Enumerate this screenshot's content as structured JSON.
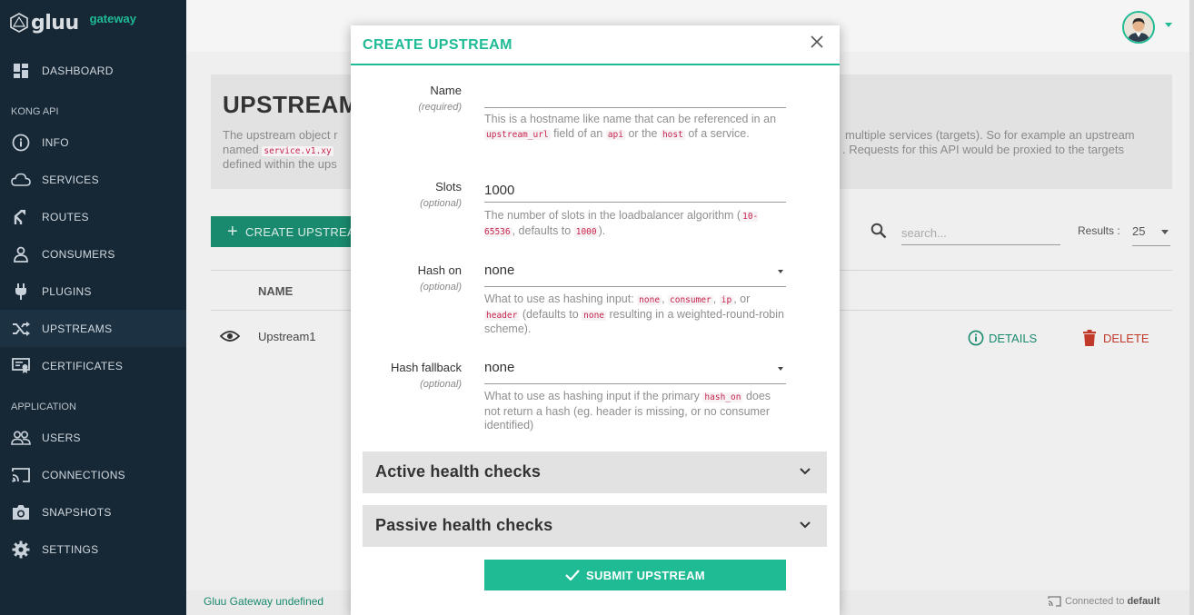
{
  "brand": {
    "name": "gluu",
    "sub": "gateway"
  },
  "sidebar": {
    "items_top": [
      {
        "label": "DASHBOARD",
        "icon": "dashboard-icon"
      }
    ],
    "section_kong": "KONG API",
    "items_kong": [
      {
        "label": "INFO",
        "icon": "info-icon"
      },
      {
        "label": "SERVICES",
        "icon": "cloud-icon"
      },
      {
        "label": "ROUTES",
        "icon": "routes-icon"
      },
      {
        "label": "CONSUMERS",
        "icon": "person-icon"
      },
      {
        "label": "PLUGINS",
        "icon": "plug-icon"
      },
      {
        "label": "UPSTREAMS",
        "icon": "shuffle-icon"
      },
      {
        "label": "CERTIFICATES",
        "icon": "certificate-icon"
      }
    ],
    "section_app": "APPLICATION",
    "items_app": [
      {
        "label": "USERS",
        "icon": "users-icon"
      },
      {
        "label": "CONNECTIONS",
        "icon": "cast-icon"
      },
      {
        "label": "SNAPSHOTS",
        "icon": "camera-icon"
      },
      {
        "label": "SETTINGS",
        "icon": "gear-icon"
      }
    ],
    "active": "UPSTREAMS"
  },
  "page": {
    "title": "UPSTREAM",
    "info_text_a": "The upstream object r",
    "info_text_b": "multiple services (targets). So for example an upstream",
    "info_text_c": "named",
    "info_code": "service.v1.xy",
    "info_text_d": ". Requests for this API would be proxied to the targets",
    "info_text_e": "defined within the ups",
    "create_button": "CREATE UPSTREA",
    "search_placeholder": "search...",
    "results_label": "Results :",
    "results_value": "25",
    "column_name": "NAME",
    "rows": [
      {
        "name": "Upstream1",
        "details": "DETAILS",
        "delete": "DELETE"
      }
    ]
  },
  "footer": {
    "left": "Gluu Gateway undefined",
    "right_prefix": "Connected to",
    "right_value": "default"
  },
  "modal": {
    "title": "CREATE UPSTREAM",
    "fields": {
      "name": {
        "label": "Name",
        "hint": "(required)",
        "value": "",
        "help_1": "This is a hostname like name that can be referenced in an",
        "help_code_1": "upstream_url",
        "help_2": "field of an",
        "help_code_2": "api",
        "help_3": "or the",
        "help_code_3": "host",
        "help_4": "of a service."
      },
      "slots": {
        "label": "Slots",
        "hint": "(optional)",
        "value": "1000",
        "help_1": "The number of slots in the loadbalancer algorithm (",
        "help_code_1": "10-65536",
        "help_2": ", defaults to",
        "help_code_2": "1000",
        "help_3": ")."
      },
      "hash_on": {
        "label": "Hash on",
        "hint": "(optional)",
        "value": "none",
        "help_1": "What to use as hashing input:",
        "help_code_1": "none",
        "help_code_2": "consumer",
        "help_code_3": "ip",
        "help_2": ", or",
        "help_code_4": "header",
        "help_3": "(defaults to",
        "help_code_5": "none",
        "help_4": "resulting in a weighted-round-robin scheme)."
      },
      "hash_fallback": {
        "label": "Hash fallback",
        "hint": "(optional)",
        "value": "none",
        "help_1": "What to use as hashing input if the primary",
        "help_code_1": "hash_on",
        "help_2": "does not return a hash (eg. header is missing, or no consumer identified)"
      }
    },
    "active_health": "Active health checks",
    "passive_health": "Passive health checks",
    "submit": "SUBMIT UPSTREAM"
  },
  "colors": {
    "accent": "#1fbb95",
    "sidebar": "#162735",
    "danger": "#c0392b"
  }
}
